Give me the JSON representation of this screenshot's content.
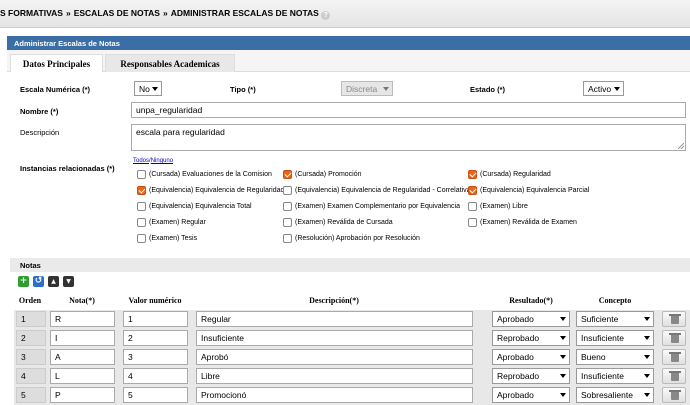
{
  "breadcrumb": {
    "items": [
      "S FORMATIVAS",
      "ESCALAS DE NOTAS",
      "ADMINISTRAR ESCALAS DE NOTAS"
    ],
    "separator": "»",
    "help": "?"
  },
  "panel": {
    "title": "Administrar Escalas de Notas"
  },
  "tabs": [
    {
      "label": "Datos Principales"
    },
    {
      "label": "Responsables Academicas"
    }
  ],
  "form": {
    "escala_numerica": {
      "label": "Escala Numérica (*)",
      "value": "No"
    },
    "tipo": {
      "label": "Tipo (*)",
      "value": "Discreta"
    },
    "estado": {
      "label": "Estado (*)",
      "value": "Activo"
    },
    "nombre": {
      "label": "Nombre (*)",
      "value": "unpa_regularidad"
    },
    "descripcion": {
      "label": "Descripción",
      "value": "escala para regularidad"
    }
  },
  "instancias": {
    "label": "Instancias relacionadas (*)",
    "todos": "Todos",
    "slash": "/",
    "ninguno": "Ninguno",
    "options": [
      {
        "label": "(Cursada) Evaluaciones de la Comision",
        "checked": false
      },
      {
        "label": "(Cursada) Promoción",
        "checked": true
      },
      {
        "label": "(Cursada) Regularidad",
        "checked": true
      },
      {
        "label": "(Equivalencia) Equivalencia de Regularidad",
        "checked": true
      },
      {
        "label": "(Equivalencia) Equivalencia de Regularidad - Correlativas",
        "checked": false
      },
      {
        "label": "(Equivalencia) Equivalencia Parcial",
        "checked": true
      },
      {
        "label": "(Equivalencia) Equivalencia Total",
        "checked": false
      },
      {
        "label": "(Examen) Examen Complementario por Equivalencia",
        "checked": false
      },
      {
        "label": "(Examen) Libre",
        "checked": false
      },
      {
        "label": "(Examen) Regular",
        "checked": false
      },
      {
        "label": "(Examen) Reválida de Cursada",
        "checked": false
      },
      {
        "label": "(Examen) Reválida de Examen",
        "checked": false
      },
      {
        "label": "(Examen) Tesis",
        "checked": false
      },
      {
        "label": "(Resolución) Aprobación por Resolución",
        "checked": false
      }
    ]
  },
  "notas": {
    "title": "Notas",
    "toolbar": {
      "add": "+",
      "undo": "↺",
      "up": "▲",
      "down": "▼"
    },
    "columns": [
      "Orden",
      "Nota(*)",
      "Valor numérico",
      "Descripción(*)",
      "Resultado(*)",
      "Concepto"
    ],
    "rows": [
      {
        "orden": "1",
        "nota": "R",
        "valor": "1",
        "descripcion": "Regular",
        "resultado": "Aprobado",
        "concepto": "Suficiente"
      },
      {
        "orden": "2",
        "nota": "I",
        "valor": "2",
        "descripcion": "Insuficiente",
        "resultado": "Reprobado",
        "concepto": "Insuficiente"
      },
      {
        "orden": "3",
        "nota": "A",
        "valor": "3",
        "descripcion": "Aprobó",
        "resultado": "Aprobado",
        "concepto": "Bueno"
      },
      {
        "orden": "4",
        "nota": "L",
        "valor": "4",
        "descripcion": "Libre",
        "resultado": "Reprobado",
        "concepto": "Insuficiente"
      },
      {
        "orden": "5",
        "nota": "P",
        "valor": "5",
        "descripcion": "Promocionó",
        "resultado": "Aprobado",
        "concepto": "Sobresaliente"
      }
    ]
  },
  "colors": {
    "panel_header": "#3a6ea5",
    "checkbox_checked": "#e8651a",
    "link": "#0000cc",
    "add_icon": "#2e9e2e",
    "undo_icon": "#2a6fc9"
  },
  "icons": [
    "help-icon",
    "add-icon",
    "undo-icon",
    "arrow-up-icon",
    "arrow-down-icon",
    "trash-icon",
    "chevron-down-icon"
  ]
}
